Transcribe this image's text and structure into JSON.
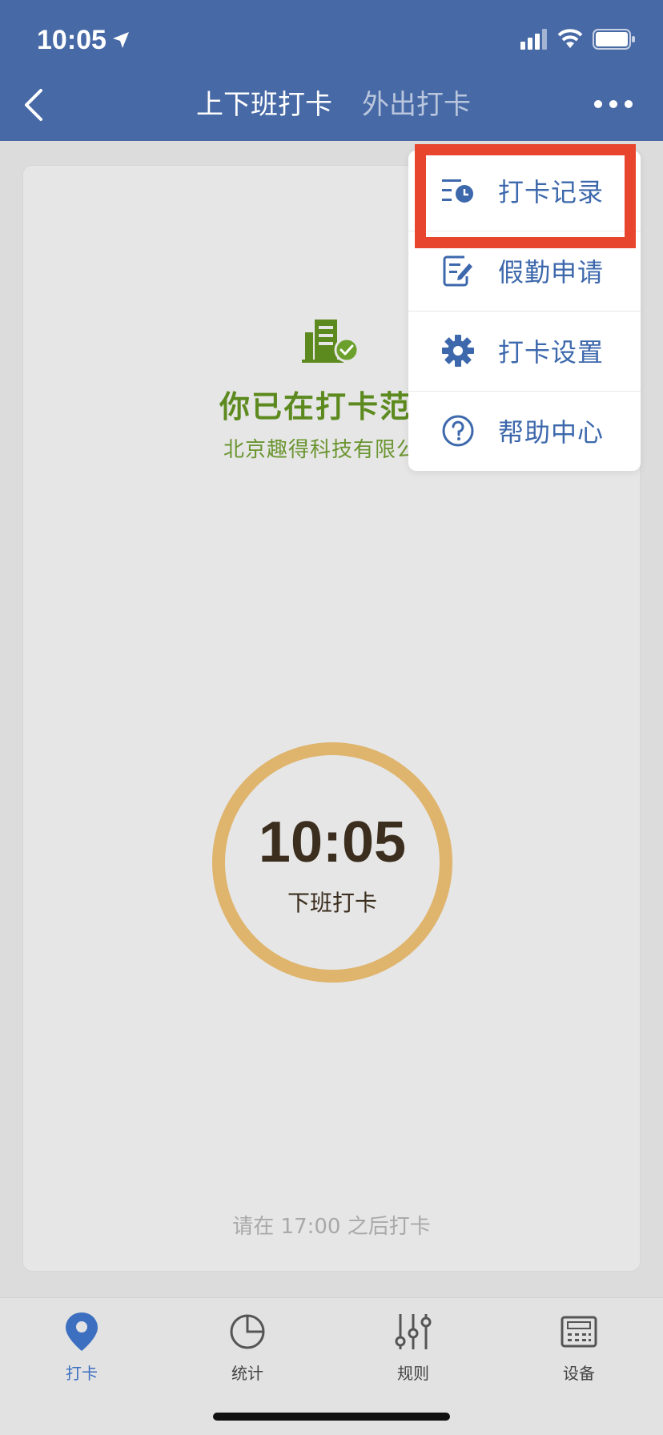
{
  "status_bar": {
    "time": "10:05"
  },
  "header": {
    "tabs": [
      {
        "label": "上下班打卡",
        "active": true
      },
      {
        "label": "外出打卡",
        "active": false
      }
    ]
  },
  "card": {
    "range_title": "你已在打卡范围",
    "company_name": "北京趣得科技有限公司",
    "clock_time": "10:05",
    "clock_label": "下班打卡",
    "hint": "请在 17:00 之后打卡"
  },
  "menu": {
    "items": [
      {
        "label": "打卡记录",
        "icon": "record-list-icon"
      },
      {
        "label": "假勤申请",
        "icon": "edit-form-icon"
      },
      {
        "label": "打卡设置",
        "icon": "gear-icon"
      },
      {
        "label": "帮助中心",
        "icon": "help-icon"
      }
    ],
    "highlight_color": "#e8452f"
  },
  "bottom_nav": {
    "items": [
      {
        "label": "打卡",
        "icon": "location-pin-icon",
        "active": true
      },
      {
        "label": "统计",
        "icon": "pie-chart-icon",
        "active": false
      },
      {
        "label": "规则",
        "icon": "sliders-icon",
        "active": false
      },
      {
        "label": "设备",
        "icon": "device-icon",
        "active": false
      }
    ]
  },
  "colors": {
    "header": "#4769a6",
    "accent": "#3d68ac",
    "success": "#5d8a1f",
    "ring": "#dfb46c"
  }
}
